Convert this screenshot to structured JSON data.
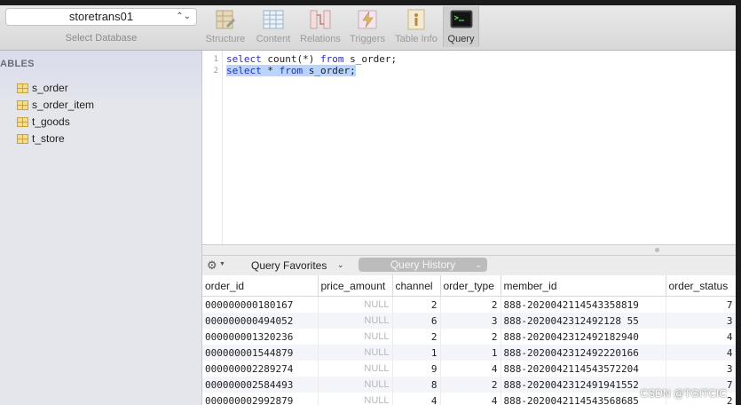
{
  "database_selector": {
    "value": "storetrans01",
    "caption": "Select Database"
  },
  "toolbar": {
    "buttons": [
      {
        "label": "Structure",
        "icon": "structure-icon"
      },
      {
        "label": "Content",
        "icon": "content-icon"
      },
      {
        "label": "Relations",
        "icon": "relations-icon"
      },
      {
        "label": "Triggers",
        "icon": "triggers-icon"
      },
      {
        "label": "Table Info",
        "icon": "table-info-icon"
      },
      {
        "label": "Query",
        "icon": "query-icon",
        "active": true
      }
    ]
  },
  "sidebar": {
    "header": "ABLES",
    "tables": [
      "s_order",
      "s_order_item",
      "t_goods",
      "t_store"
    ]
  },
  "editor": {
    "lines": [
      {
        "number": "1",
        "kw1": "select",
        "mid": " count(*) ",
        "kw2": "from",
        "rest": " s_order;"
      },
      {
        "number": "2",
        "kw1": "select",
        "mid": " * ",
        "kw2": "from",
        "rest": " s_order;"
      }
    ]
  },
  "results_toolbar": {
    "favorites_label": "Query Favorites",
    "history_label": "Query History"
  },
  "results": {
    "columns": [
      "order_id",
      "price_amount",
      "channel",
      "order_type",
      "member_id",
      "order_status"
    ],
    "rows": [
      [
        "000000000180167",
        "NULL",
        "2",
        "2",
        "888-2020042114543358819",
        "7"
      ],
      [
        "000000000494052",
        "NULL",
        "6",
        "3",
        "888-2020042312492128 55",
        "3"
      ],
      [
        "000000001320236",
        "NULL",
        "2",
        "2",
        "888-2020042312492182940",
        "4"
      ],
      [
        "000000001544879",
        "NULL",
        "1",
        "1",
        "888-2020042312492220166",
        "4"
      ],
      [
        "000000002289274",
        "NULL",
        "9",
        "4",
        "888-2020042114543572204",
        "3"
      ],
      [
        "000000002584493",
        "NULL",
        "8",
        "2",
        "888-2020042312491941552",
        "7"
      ],
      [
        "000000002992879",
        "NULL",
        "4",
        "4",
        "888-2020042114543568685",
        "2"
      ]
    ]
  },
  "watermark": "CSDN @TGITCIC"
}
